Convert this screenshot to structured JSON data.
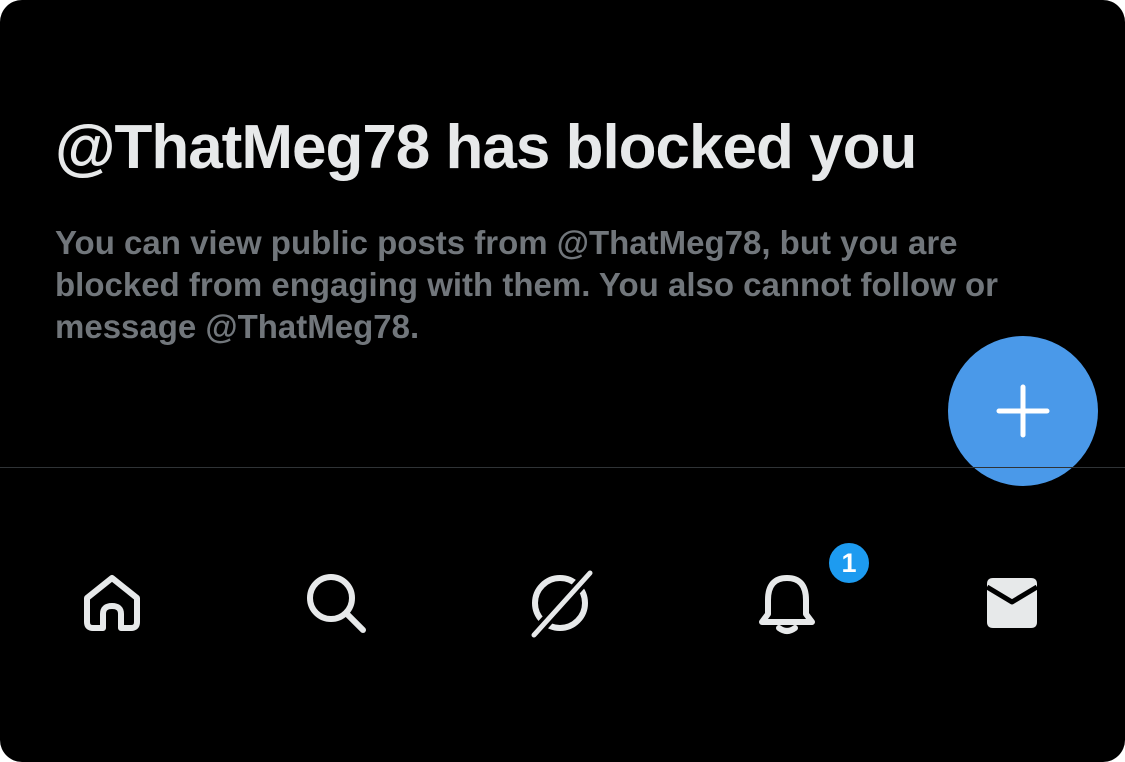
{
  "blocked_notice": {
    "title": "@ThatMeg78 has blocked you",
    "message": "You can view public posts from @ThatMeg78, but you are blocked from engaging with them. You also cannot follow or message @ThatMeg78."
  },
  "compose_button": {
    "icon": "plus-icon",
    "color": "#4a99e9"
  },
  "tab_bar": {
    "tabs": [
      {
        "name": "home",
        "icon": "home-icon"
      },
      {
        "name": "search",
        "icon": "search-icon"
      },
      {
        "name": "grok",
        "icon": "grok-icon"
      },
      {
        "name": "notifications",
        "icon": "bell-icon",
        "badge": "1"
      },
      {
        "name": "messages",
        "icon": "envelope-icon"
      }
    ]
  },
  "colors": {
    "background": "#000000",
    "title": "#e7e9ea",
    "message": "#71767b",
    "accent": "#1d9bf0"
  }
}
